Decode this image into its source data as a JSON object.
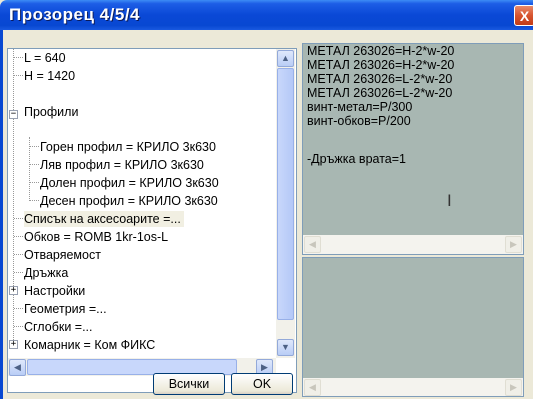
{
  "window": {
    "title": "Прозорец  4/5/4",
    "close_glyph": "X"
  },
  "tree": {
    "nodes": [
      {
        "label": "L = 640"
      },
      {
        "label": "H = 1420"
      },
      {
        "label": "Профили",
        "expander": "−"
      },
      {
        "label": "Горен профил =   КРИЛО 3к630"
      },
      {
        "label": "Ляв профил =   КРИЛО 3к630"
      },
      {
        "label": "Долен профил =   КРИЛО 3к630"
      },
      {
        "label": "Десен профил = КРИЛО 3к630"
      },
      {
        "label": "Списък на аксесоарите =..."
      },
      {
        "label": "Обков =   ROMB 1kr-1os-L"
      },
      {
        "label": "Отваряемост"
      },
      {
        "label": "Дръжка"
      },
      {
        "label": "Настройки",
        "expander": "+"
      },
      {
        "label": "Геометрия  =..."
      },
      {
        "label": "Сглобки  =..."
      },
      {
        "label": "Комарник =  Ком ФИКС",
        "expander": "+"
      }
    ]
  },
  "memo_top": {
    "lines": [
      "МЕТАЛ 263026=H-2*w-20",
      "МЕТАЛ 263026=H-2*w-20",
      "МЕТАЛ 263026=L-2*w-20",
      "МЕТАЛ 263026=L-2*w-20",
      "винт-метал=P/300",
      "винт-обков=P/200",
      "",
      "-Дръжка врата=1"
    ]
  },
  "buttons": {
    "all": "Всички",
    "ok": "OK"
  },
  "icons": {
    "close": "close-icon",
    "up": "arrow-up-icon",
    "down": "arrow-down-icon",
    "left": "arrow-left-icon",
    "right": "arrow-right-icon",
    "cursor": "text-cursor-icon"
  },
  "colors": {
    "title_bar": "#0848d2",
    "memo_bg": "#a8b7b2",
    "close": "#d7542f"
  }
}
